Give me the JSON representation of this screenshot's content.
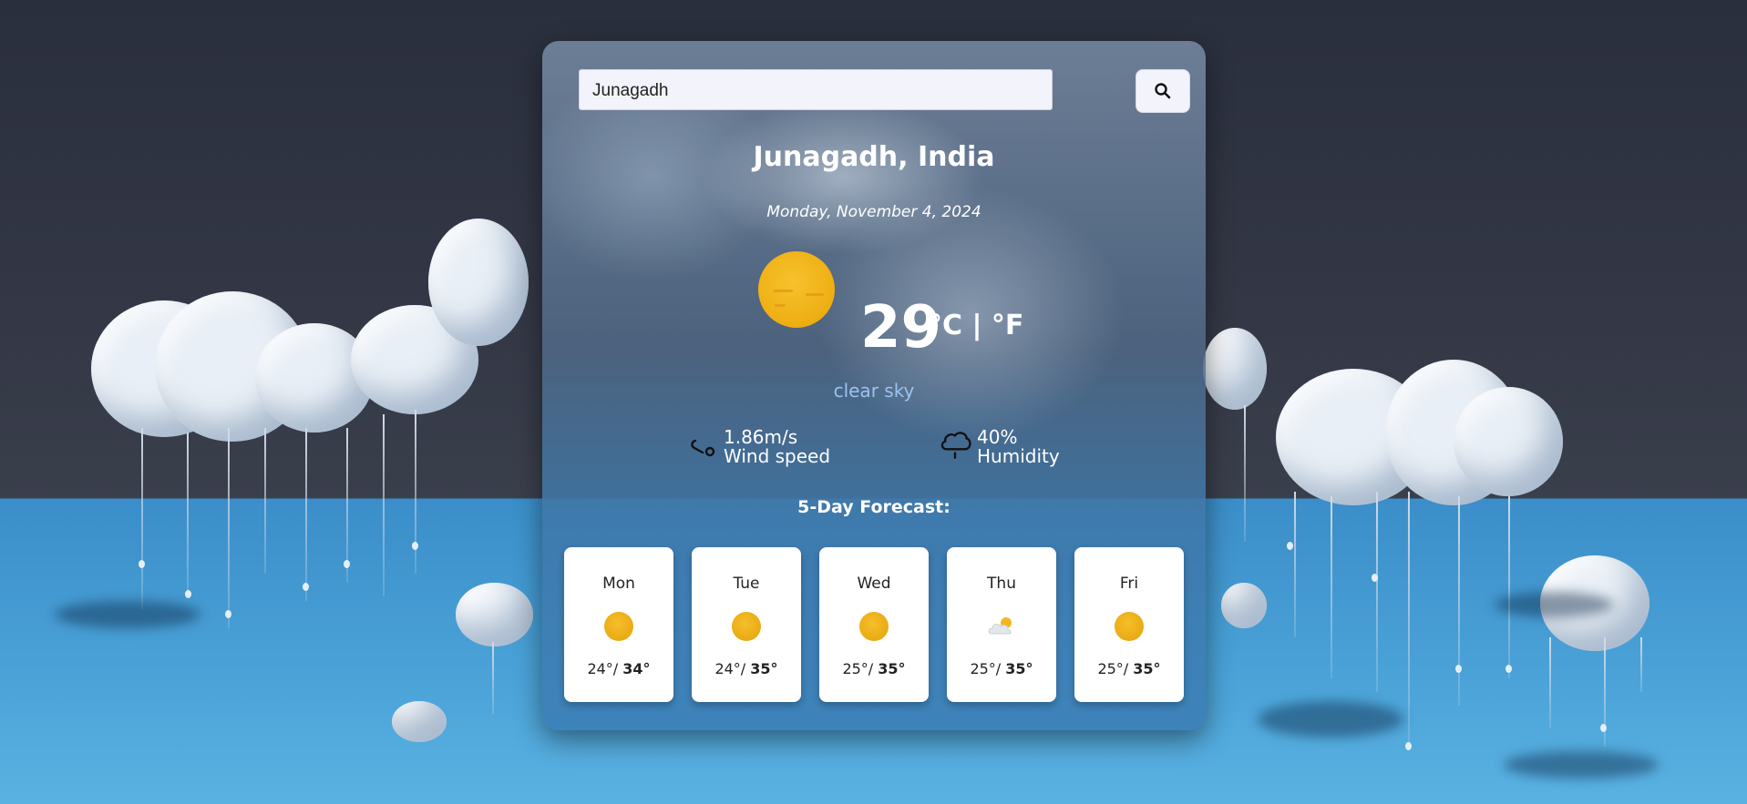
{
  "search": {
    "value": "Junagadh"
  },
  "location": {
    "title": "Junagadh, India",
    "date": "Monday, November 4, 2024"
  },
  "current": {
    "icon": "sun-icon",
    "temperature": "29",
    "units": "°C | °F",
    "description": "clear sky",
    "wind": {
      "value": "1.86m/s",
      "label": "Wind speed",
      "icon": "wind-icon"
    },
    "humidity": {
      "value": "40%",
      "label": "Humidity",
      "icon": "humidity-cloud-icon"
    }
  },
  "forecast": {
    "title": "5-Day Forecast:",
    "days": [
      {
        "day": "Mon",
        "icon": "sun-icon",
        "min": "24°/",
        "max": "34°"
      },
      {
        "day": "Tue",
        "icon": "sun-icon",
        "min": "24°/",
        "max": "35°"
      },
      {
        "day": "Wed",
        "icon": "sun-icon",
        "min": "25°/",
        "max": "35°"
      },
      {
        "day": "Thu",
        "icon": "few-clouds-icon",
        "min": "25°/",
        "max": "35°"
      },
      {
        "day": "Fri",
        "icon": "sun-icon",
        "min": "25°/",
        "max": "35°"
      }
    ]
  },
  "colors": {
    "accent_description": "#9cc3ee",
    "sun": "#eeae12",
    "card_bg": "#ffffff"
  }
}
